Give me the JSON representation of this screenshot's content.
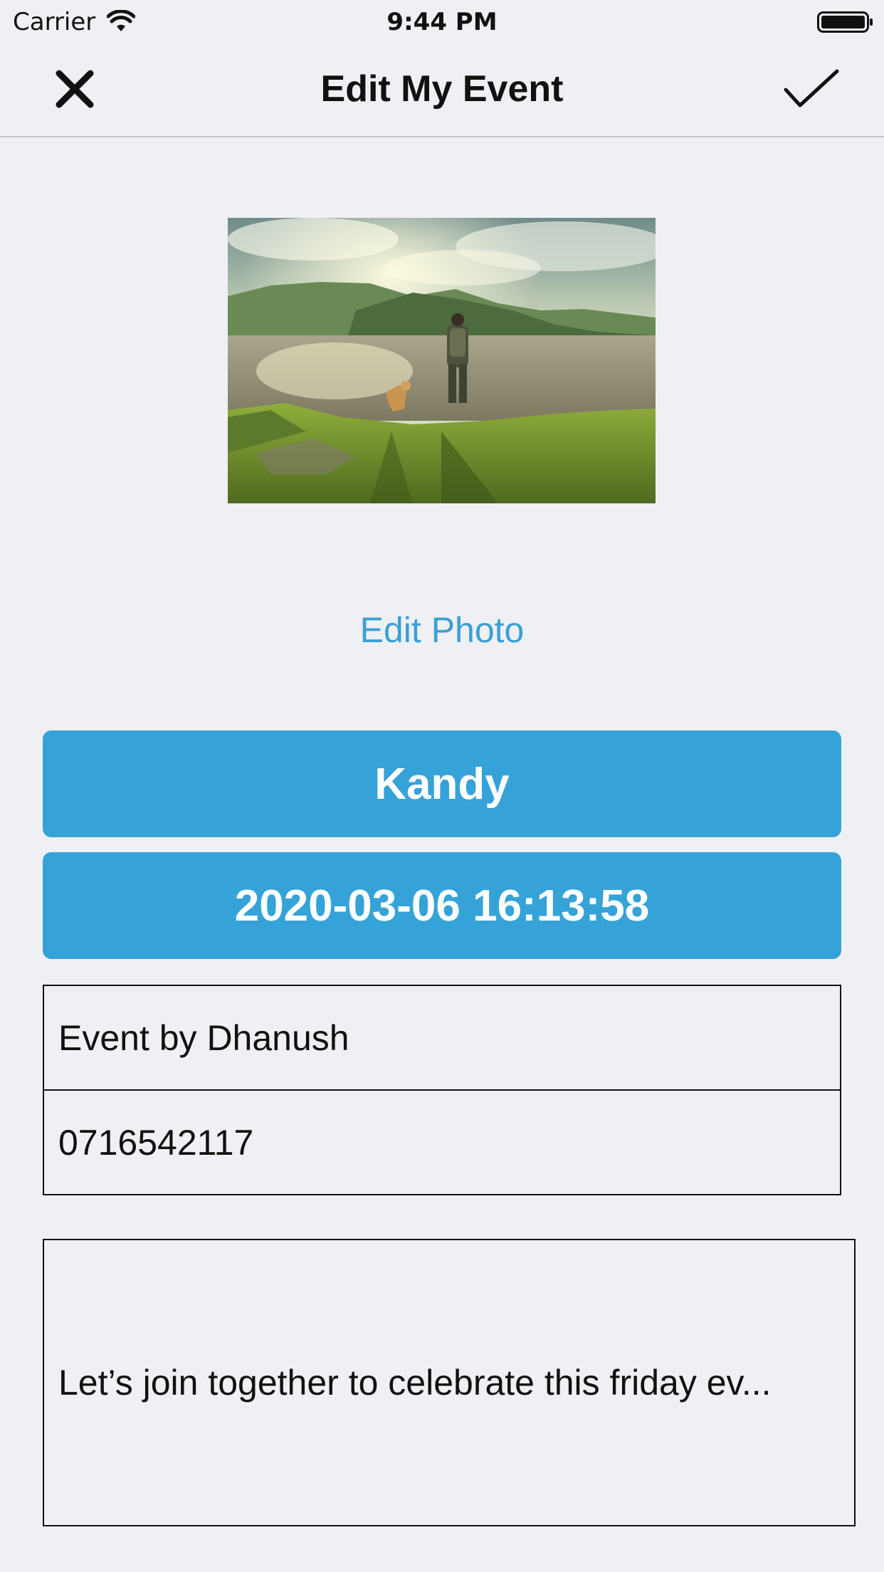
{
  "status_bar": {
    "carrier": "Carrier",
    "time": "9:44 PM",
    "wifi_icon": "wifi-icon",
    "battery_icon": "battery-icon"
  },
  "nav": {
    "title": "Edit My Event",
    "close_icon": "close-icon",
    "done_icon": "checkmark-icon"
  },
  "photo": {
    "description_icon": "landscape-photo",
    "edit_label": "Edit Photo"
  },
  "event": {
    "location": "Kandy",
    "datetime": "2020-03-06 16:13:58",
    "organizer": "Event by Dhanush",
    "phone": "0716542117",
    "description": "Let’s join together to celebrate this friday ev..."
  },
  "colors": {
    "accent": "#35a3d8",
    "link": "#3aa0d6",
    "background": "#eff0f4"
  }
}
